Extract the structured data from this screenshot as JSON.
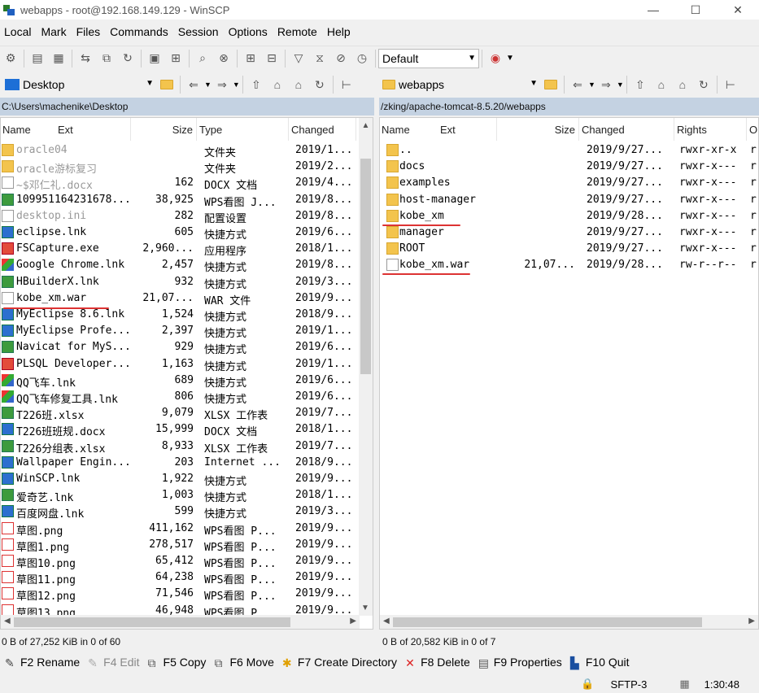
{
  "window": {
    "title": "webapps - root@192.168.149.129 - WinSCP",
    "min": "—",
    "max": "☐",
    "close": "✕"
  },
  "menu": [
    "Local",
    "Mark",
    "Files",
    "Commands",
    "Session",
    "Options",
    "Remote",
    "Help"
  ],
  "toolbar": {
    "transfer_profile": "Default"
  },
  "left": {
    "drive": "Desktop",
    "path": "C:\\Users\\machenike\\Desktop",
    "columns": [
      "Name",
      "Ext",
      "Size",
      "Type",
      "Changed"
    ],
    "rows": [
      {
        "name": "oracle04",
        "size": "",
        "type": "文件夹",
        "changed": "2019/1...",
        "icon": "folder",
        "dim": true
      },
      {
        "name": "oracle游标复习",
        "size": "",
        "type": "文件夹",
        "changed": "2019/2...",
        "icon": "folder",
        "dim": true
      },
      {
        "name": "~$邓仁礼.docx",
        "size": "162",
        "type": "DOCX 文档",
        "changed": "2019/4...",
        "icon": "file",
        "dim": true
      },
      {
        "name": "109951164231678...",
        "size": "38,925",
        "type": "WPS看图 J...",
        "changed": "2019/8...",
        "icon": "green"
      },
      {
        "name": "desktop.ini",
        "size": "282",
        "type": "配置设置",
        "changed": "2019/8...",
        "icon": "file",
        "dim": true
      },
      {
        "name": "eclipse.lnk",
        "size": "605",
        "type": "快捷方式",
        "changed": "2019/6...",
        "icon": "blue"
      },
      {
        "name": "FSCapture.exe",
        "size": "2,960...",
        "type": "应用程序",
        "changed": "2018/1...",
        "icon": "red"
      },
      {
        "name": "Google Chrome.lnk",
        "size": "2,457",
        "type": "快捷方式",
        "changed": "2019/8...",
        "icon": "multi"
      },
      {
        "name": "HBuilderX.lnk",
        "size": "932",
        "type": "快捷方式",
        "changed": "2019/3...",
        "icon": "green"
      },
      {
        "name": "kobe_xm.war",
        "size": "21,07...",
        "type": "WAR 文件",
        "changed": "2019/9...",
        "icon": "file"
      },
      {
        "name": "MyEclipse 8.6.lnk",
        "size": "1,524",
        "type": "快捷方式",
        "changed": "2018/9...",
        "icon": "blue"
      },
      {
        "name": "MyEclipse Profe...",
        "size": "2,397",
        "type": "快捷方式",
        "changed": "2019/1...",
        "icon": "blue"
      },
      {
        "name": "Navicat for MyS...",
        "size": "929",
        "type": "快捷方式",
        "changed": "2019/6...",
        "icon": "green"
      },
      {
        "name": "PLSQL Developer...",
        "size": "1,163",
        "type": "快捷方式",
        "changed": "2019/1...",
        "icon": "red"
      },
      {
        "name": "QQ飞车.lnk",
        "size": "689",
        "type": "快捷方式",
        "changed": "2019/6...",
        "icon": "multi"
      },
      {
        "name": "QQ飞车修复工具.lnk",
        "size": "806",
        "type": "快捷方式",
        "changed": "2019/6...",
        "icon": "multi"
      },
      {
        "name": "T226班.xlsx",
        "size": "9,079",
        "type": "XLSX 工作表",
        "changed": "2019/7...",
        "icon": "green"
      },
      {
        "name": "T226班班规.docx",
        "size": "15,999",
        "type": "DOCX 文档",
        "changed": "2018/1...",
        "icon": "blue"
      },
      {
        "name": "T226分组表.xlsx",
        "size": "8,933",
        "type": "XLSX 工作表",
        "changed": "2019/7...",
        "icon": "green"
      },
      {
        "name": "Wallpaper Engin...",
        "size": "203",
        "type": "Internet ...",
        "changed": "2018/9...",
        "icon": "blue"
      },
      {
        "name": "WinSCP.lnk",
        "size": "1,922",
        "type": "快捷方式",
        "changed": "2019/9...",
        "icon": "blue"
      },
      {
        "name": "爱奇艺.lnk",
        "size": "1,003",
        "type": "快捷方式",
        "changed": "2018/1...",
        "icon": "green"
      },
      {
        "name": "百度网盘.lnk",
        "size": "599",
        "type": "快捷方式",
        "changed": "2019/3...",
        "icon": "blue"
      },
      {
        "name": "草图.png",
        "size": "411,162",
        "type": "WPS看图 P...",
        "changed": "2019/9...",
        "icon": "png"
      },
      {
        "name": "草图1.png",
        "size": "278,517",
        "type": "WPS看图 P...",
        "changed": "2019/9...",
        "icon": "png"
      },
      {
        "name": "草图10.png",
        "size": "65,412",
        "type": "WPS看图 P...",
        "changed": "2019/9...",
        "icon": "png"
      },
      {
        "name": "草图11.png",
        "size": "64,238",
        "type": "WPS看图 P...",
        "changed": "2019/9...",
        "icon": "png"
      },
      {
        "name": "草图12.png",
        "size": "71,546",
        "type": "WPS看图 P...",
        "changed": "2019/9...",
        "icon": "png"
      },
      {
        "name": "草图13.png",
        "size": "46,948",
        "type": "WPS看图 P...",
        "changed": "2019/9...",
        "icon": "png"
      }
    ],
    "status": "0 B of 27,252 KiB in 0 of 60"
  },
  "right": {
    "folder": "webapps",
    "path": "/zking/apache-tomcat-8.5.20/webapps",
    "columns": [
      "Name",
      "Ext",
      "Size",
      "Changed",
      "Rights",
      "O"
    ],
    "rows": [
      {
        "name": "..",
        "size": "",
        "changed": "2019/9/27...",
        "rights": "rwxr-xr-x",
        "owner": "r",
        "icon": "up"
      },
      {
        "name": "docs",
        "size": "",
        "changed": "2019/9/27...",
        "rights": "rwxr-x---",
        "owner": "r",
        "icon": "folder"
      },
      {
        "name": "examples",
        "size": "",
        "changed": "2019/9/27...",
        "rights": "rwxr-x---",
        "owner": "r",
        "icon": "folder"
      },
      {
        "name": "host-manager",
        "size": "",
        "changed": "2019/9/27...",
        "rights": "rwxr-x---",
        "owner": "r",
        "icon": "folder"
      },
      {
        "name": "kobe_xm",
        "size": "",
        "changed": "2019/9/28...",
        "rights": "rwxr-x---",
        "owner": "r",
        "icon": "folder"
      },
      {
        "name": "manager",
        "size": "",
        "changed": "2019/9/27...",
        "rights": "rwxr-x---",
        "owner": "r",
        "icon": "folder"
      },
      {
        "name": "ROOT",
        "size": "",
        "changed": "2019/9/27...",
        "rights": "rwxr-x---",
        "owner": "r",
        "icon": "folder"
      },
      {
        "name": "kobe_xm.war",
        "size": "21,07...",
        "changed": "2019/9/28...",
        "rights": "rw-r--r--",
        "owner": "r",
        "icon": "file"
      }
    ],
    "status": "0 B of 20,582 KiB in 0 of 7"
  },
  "fkeys": [
    {
      "label": "F2 Rename",
      "disabled": false
    },
    {
      "label": "F4 Edit",
      "disabled": true
    },
    {
      "label": "F5 Copy",
      "disabled": false
    },
    {
      "label": "F6 Move",
      "disabled": false
    },
    {
      "label": "F7 Create Directory",
      "disabled": false
    },
    {
      "label": "F8 Delete",
      "disabled": false
    },
    {
      "label": "F9 Properties",
      "disabled": false
    },
    {
      "label": "F10 Quit",
      "disabled": false
    }
  ],
  "statusbar": {
    "protocol": "SFTP-3",
    "time": "1:30:48"
  }
}
